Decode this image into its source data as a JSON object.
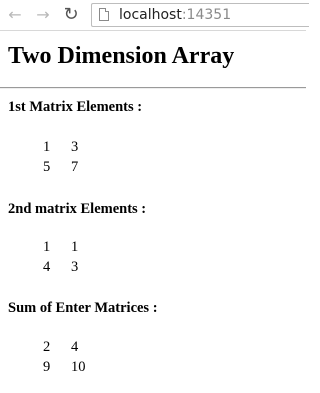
{
  "browser": {
    "url_host": "localhost",
    "url_port": ":14351",
    "back_icon": "arrow-left-icon",
    "forward_icon": "arrow-right-icon",
    "reload_icon": "reload-icon",
    "page_icon": "page-icon"
  },
  "page": {
    "title": "Two Dimension Array",
    "sections": [
      {
        "heading": "1st Matrix Elements :",
        "rows": [
          [
            "1",
            "3"
          ],
          [
            "5",
            "7"
          ]
        ]
      },
      {
        "heading": "2nd matrix Elements :",
        "rows": [
          [
            "1",
            "1"
          ],
          [
            "4",
            "3"
          ]
        ]
      },
      {
        "heading": "Sum of Enter Matrices :",
        "rows": [
          [
            "2",
            "4"
          ],
          [
            "9",
            "10"
          ]
        ]
      }
    ]
  }
}
